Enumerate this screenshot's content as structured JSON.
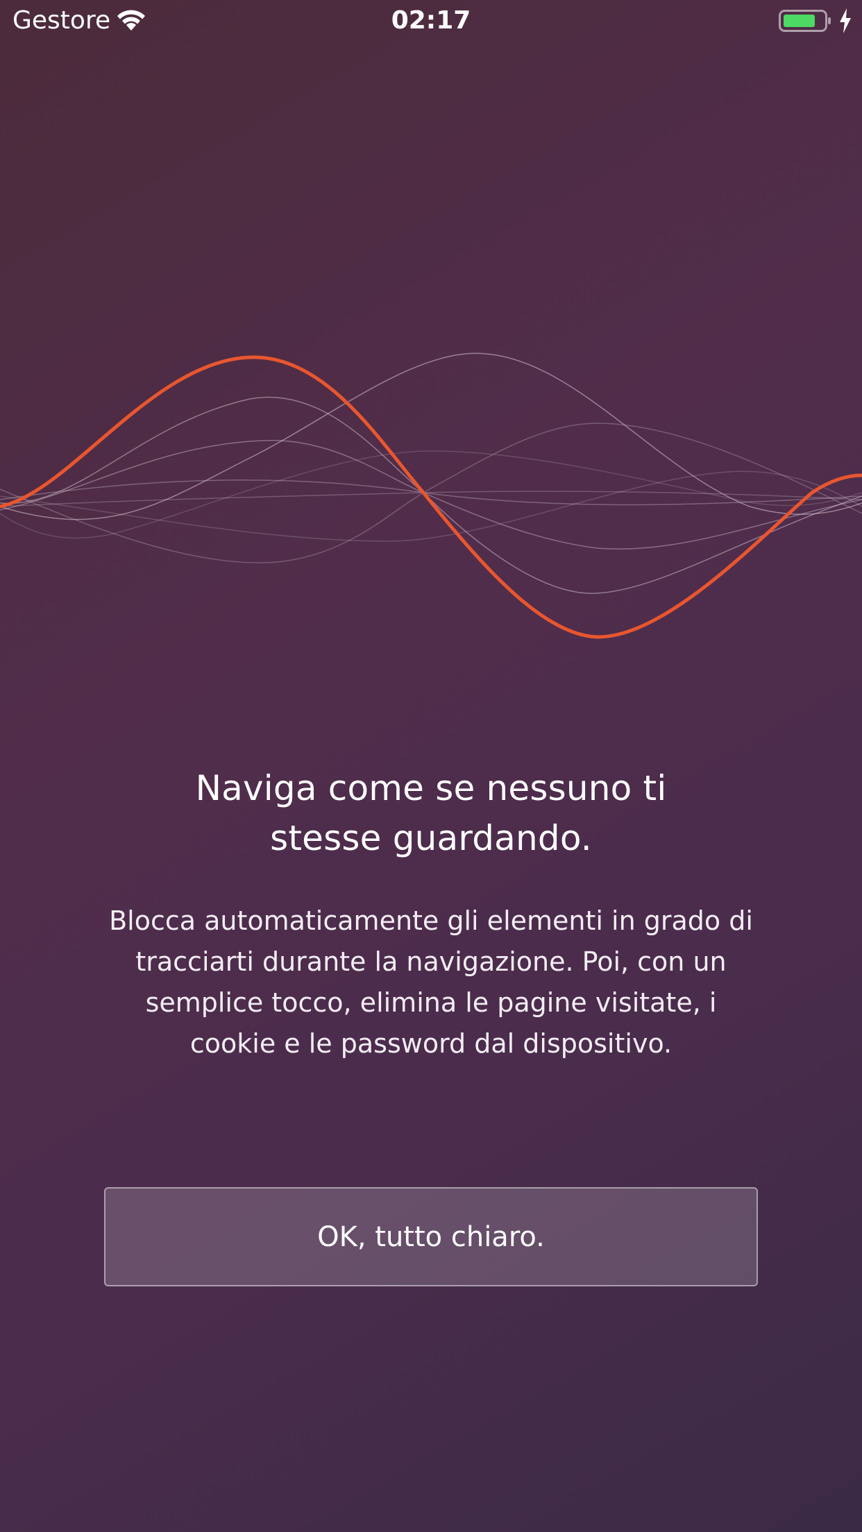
{
  "status_bar": {
    "carrier": "Gestore",
    "time": "02:17",
    "wifi_icon": "wifi-icon",
    "battery_icon": "battery-icon",
    "charging_icon": "charging-bolt-icon",
    "battery_color": "#4cd964"
  },
  "illustration": {
    "icon": "sound-wave-illustration",
    "accent_color": "#e8562f",
    "line_color": "#c9b8c7"
  },
  "onboarding": {
    "headline_line1": "Naviga come se nessuno ti",
    "headline_line2": "stesse guardando.",
    "description_line1": "Blocca automaticamente gli elementi in grado di",
    "description_line2": "tracciarti durante la navigazione. Poi, con un",
    "description_line3": "semplice tocco, elimina le pagine visitate, i",
    "description_line4": "cookie e le password dal dispositivo.",
    "ok_button": "OK, tutto chiaro."
  }
}
